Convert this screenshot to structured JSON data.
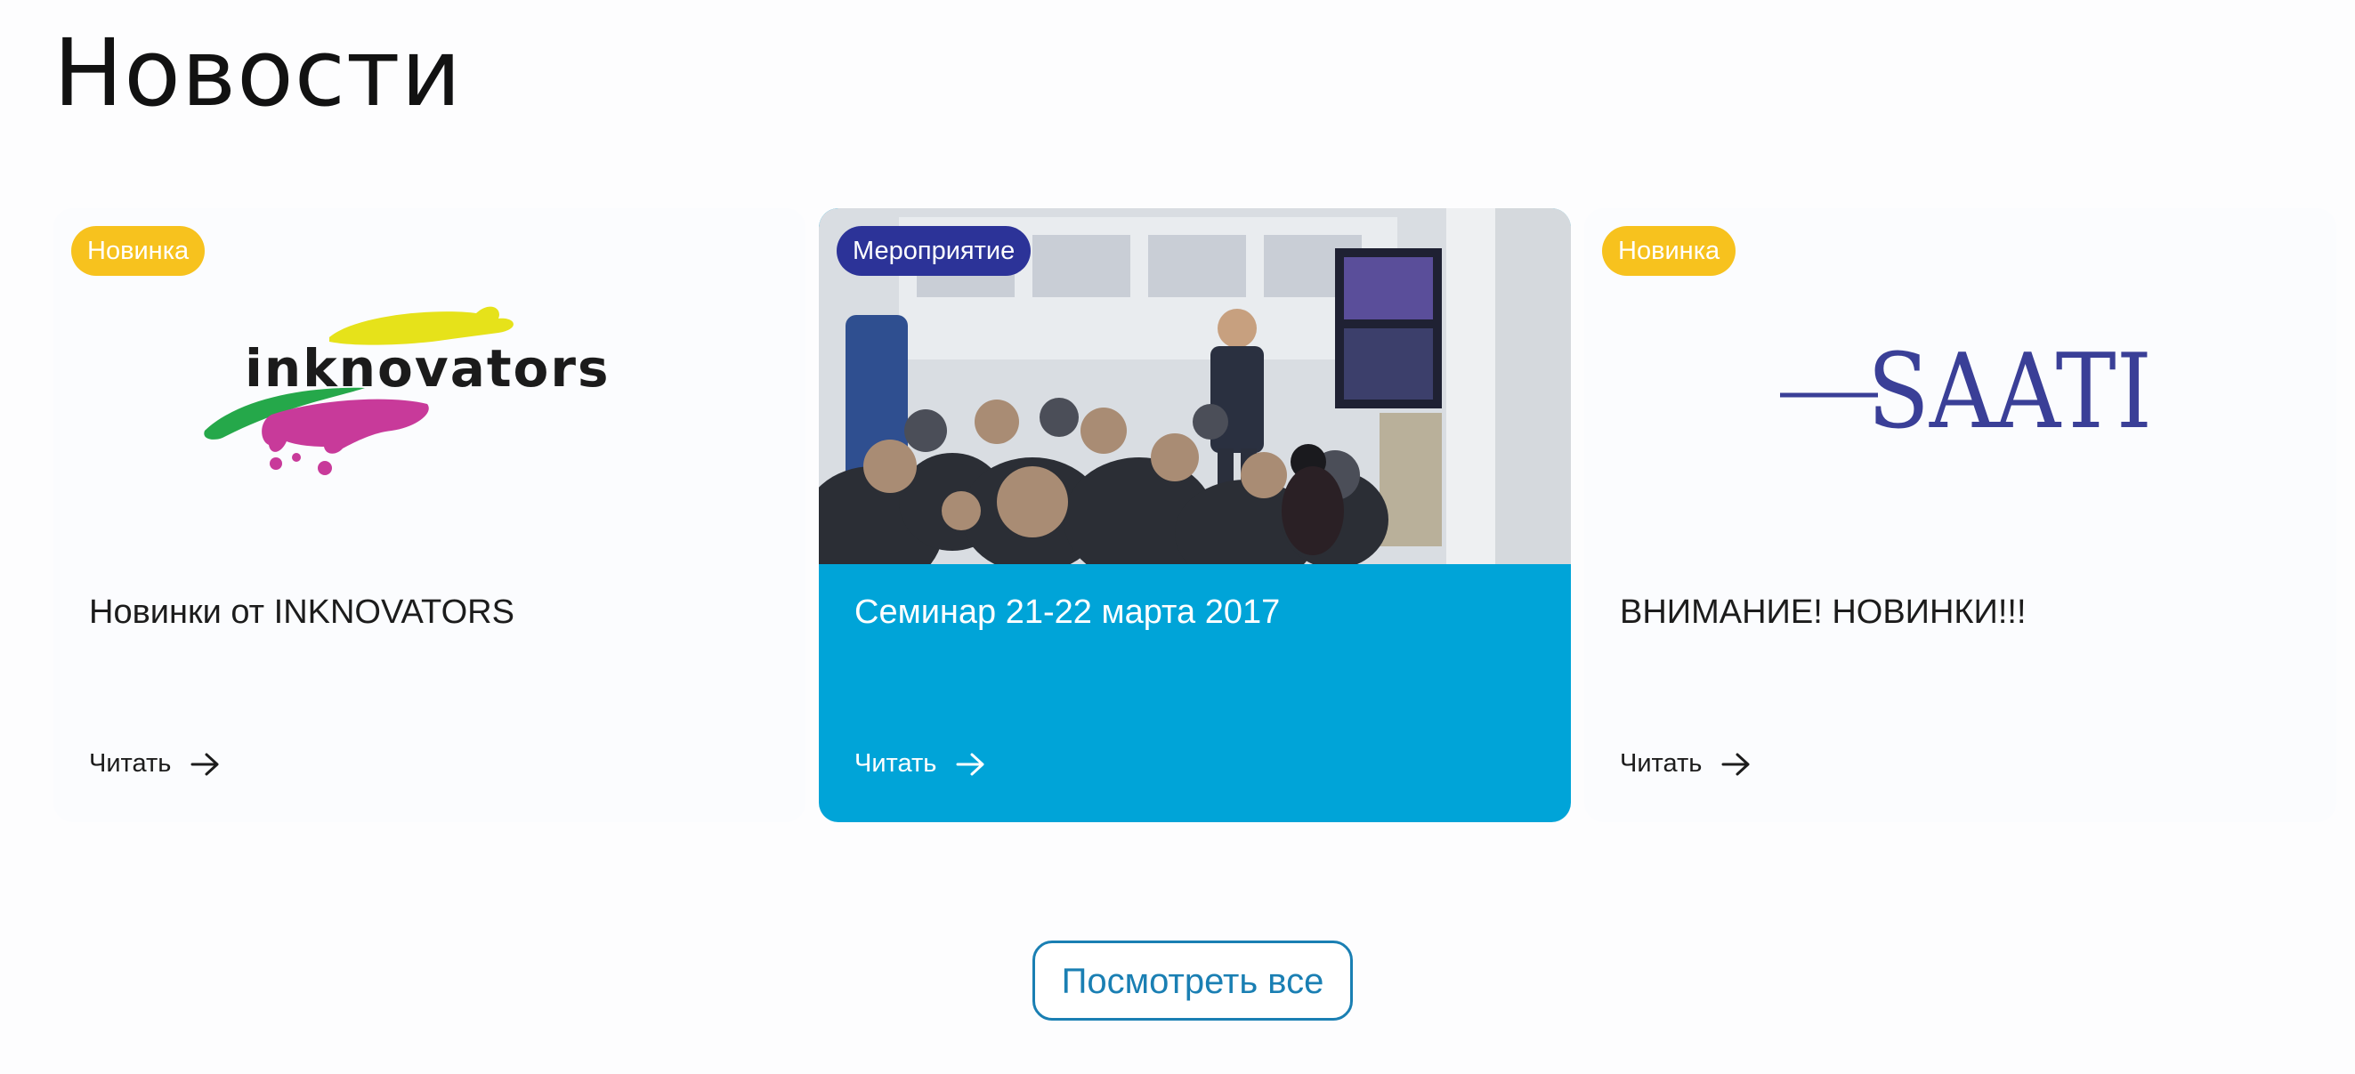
{
  "page": {
    "title": "Новости"
  },
  "news": [
    {
      "badge": "Новинка",
      "logo_text": "inknovators",
      "title": "Новинки от INKNOVATORS",
      "read_label": "Читать"
    },
    {
      "badge": "Мероприятие",
      "title": "Семинар 21-22 марта 2017",
      "read_label": "Читать"
    },
    {
      "badge": "Новинка",
      "logo_text": "SAATI",
      "title": "ВНИМАНИЕ! НОВИНКИ!!!",
      "read_label": "Читать"
    }
  ],
  "actions": {
    "view_all_label": "Посмотреть все"
  },
  "colors": {
    "badge_new": "#f7c21e",
    "badge_event": "#2c3398",
    "featured_card": "#00a4d8",
    "link_accent": "#1a7fb3"
  }
}
